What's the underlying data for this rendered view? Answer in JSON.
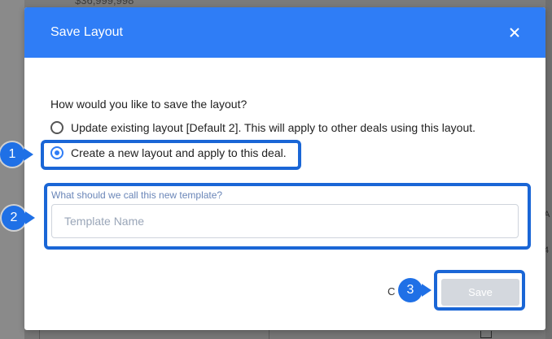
{
  "background": {
    "price_text": "$36,999,998"
  },
  "modal": {
    "title": "Save Layout",
    "question": "How would you like to save the layout?",
    "options": [
      {
        "label": "Update existing layout [Default 2]. This will apply to other deals using this layout.",
        "checked": false
      },
      {
        "label": "Create a new layout and apply to this deal.",
        "checked": true
      }
    ],
    "field_label": "What should we call this new template?",
    "field_placeholder": "Template Name",
    "field_value": "",
    "cancel_label": "C",
    "save_label": "Save"
  },
  "steps": [
    "1",
    "2",
    "3"
  ],
  "colors": {
    "header": "#2f7df6",
    "highlight": "#1a66d6",
    "save_disabled": "#d4d8de"
  }
}
